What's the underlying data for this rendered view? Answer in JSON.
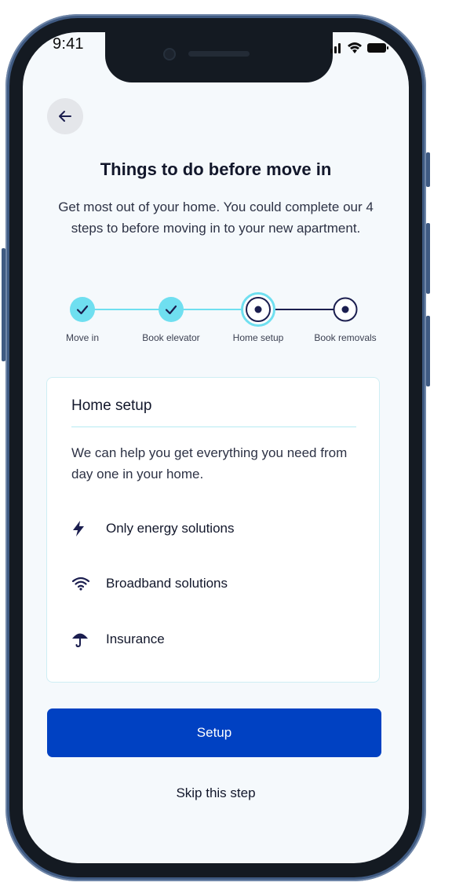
{
  "status_bar": {
    "time": "9:41"
  },
  "header": {
    "title": "Things to do before move in",
    "subtitle": "Get most out of your home. You could complete our 4 steps to before moving in to your new apartment."
  },
  "stepper": {
    "steps": [
      {
        "label": "Move in",
        "state": "completed"
      },
      {
        "label": "Book elevator",
        "state": "completed"
      },
      {
        "label": "Home setup",
        "state": "current"
      },
      {
        "label": "Book removals",
        "state": "upcoming"
      }
    ]
  },
  "card": {
    "title": "Home setup",
    "description": "We can help you get everything you need from day one in your home.",
    "options": [
      {
        "label": "Only energy solutions",
        "icon": "lightning-icon"
      },
      {
        "label": "Broadband solutions",
        "icon": "wifi-icon"
      },
      {
        "label": "Insurance",
        "icon": "umbrella-icon"
      }
    ]
  },
  "actions": {
    "primary_label": "Setup",
    "skip_label": "Skip this step"
  },
  "colors": {
    "primary": "#0041c2",
    "completed_step": "#6fdff0",
    "dark": "#1b1e4f"
  }
}
